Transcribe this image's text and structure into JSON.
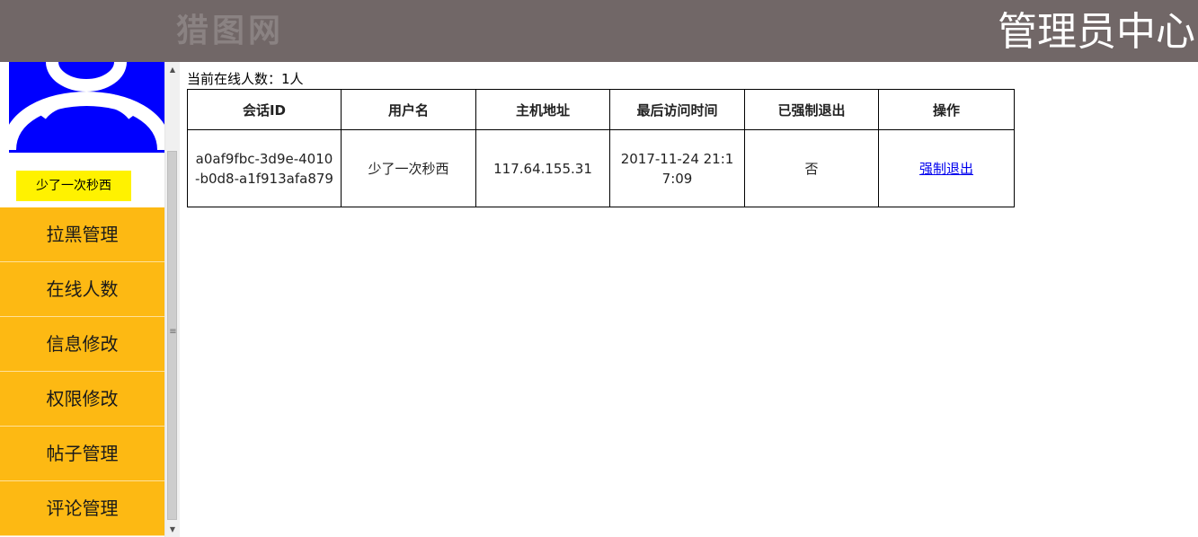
{
  "header": {
    "watermark": "猎图网",
    "title": "管理员中心"
  },
  "sidebar": {
    "avatar_icon": "user-avatar-icon",
    "username": "少了一次秒西",
    "items": [
      {
        "label": "拉黑管理"
      },
      {
        "label": "在线人数"
      },
      {
        "label": "信息修改"
      },
      {
        "label": "权限修改"
      },
      {
        "label": "帖子管理"
      },
      {
        "label": "评论管理"
      }
    ]
  },
  "main": {
    "online_count": "当前在线人数：1人",
    "table": {
      "headers": [
        "会话ID",
        "用户名",
        "主机地址",
        "最后访问时间",
        "已强制退出",
        "操作"
      ],
      "rows": [
        {
          "session_id": "a0af9fbc-3d9e-4010-b0d8-a1f913afa879",
          "username": "少了一次秒西",
          "host": "117.64.155.31",
          "last_access": "2017-11-24 21:17:09",
          "forced_out": "否",
          "action": "强制退出"
        }
      ]
    }
  },
  "colors": {
    "header_bg": "#716767",
    "menu_bg": "#fdb913",
    "username_bg": "#fff200",
    "avatar_bg": "#0000ff",
    "link": "#0000ee"
  }
}
